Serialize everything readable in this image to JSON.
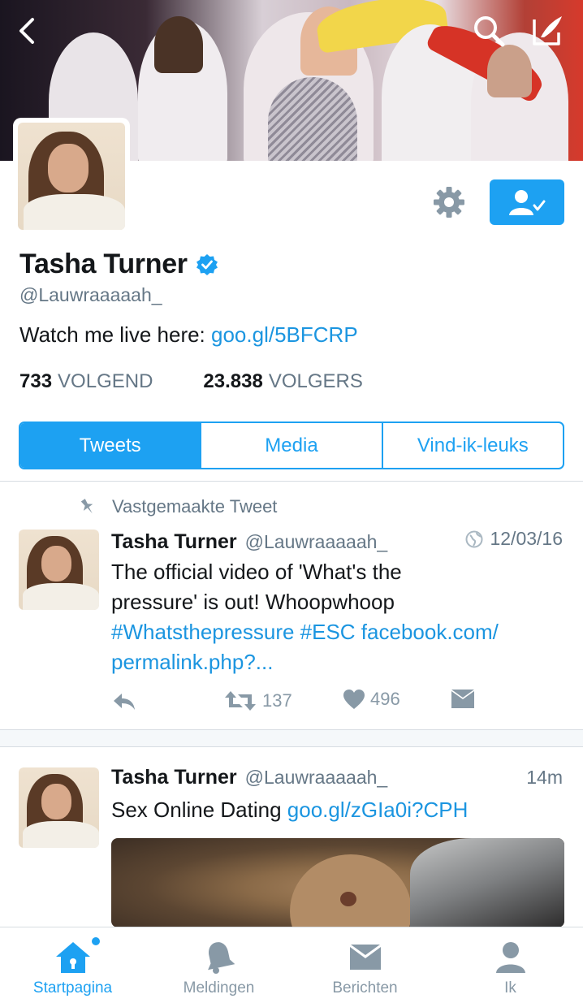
{
  "header": {
    "back_icon": "chevron-left-icon",
    "search_icon": "search-icon",
    "compose_icon": "compose-icon"
  },
  "profile": {
    "name": "Tasha Turner",
    "handle": "@Lauwraaaaah_",
    "verified": true,
    "bio_text": "Watch me live here: ",
    "bio_link": "goo.gl/5BFCRP",
    "following_count": "733",
    "following_label": "VOLGEND",
    "followers_count": "23.838",
    "followers_label": "VOLGERS"
  },
  "tabs": [
    {
      "label": "Tweets",
      "active": true
    },
    {
      "label": "Media",
      "active": false
    },
    {
      "label": "Vind-ik-leuks",
      "active": false
    }
  ],
  "pinned_label": "Vastgemaakte Tweet",
  "tweets": [
    {
      "name": "Tasha Turner",
      "handle": "@Lauwraaaaah_",
      "time": "12/03/16",
      "text_line1": "The official video of 'What's the",
      "text_line2": "pressure' is out! Whoopwhoop",
      "link_line1": "#Whatsthepressure #ESC facebook.com/",
      "link_line2": "permalink.php?...",
      "retweets": "137",
      "likes": "496"
    },
    {
      "name": "Tasha Turner",
      "handle": "@Lauwraaaaah_",
      "time": "14m",
      "text": "Sex Online Dating ",
      "link": "goo.gl/zGIa0i?CPH"
    }
  ],
  "bottom_nav": [
    {
      "label": "Startpagina",
      "icon": "home-icon",
      "active": true
    },
    {
      "label": "Meldingen",
      "icon": "bell-icon",
      "active": false
    },
    {
      "label": "Berichten",
      "icon": "envelope-icon",
      "active": false
    },
    {
      "label": "Ik",
      "icon": "person-icon",
      "active": false
    }
  ],
  "colors": {
    "accent": "#1da1f2",
    "link": "#1b95e0",
    "secondary_text": "#657786"
  }
}
